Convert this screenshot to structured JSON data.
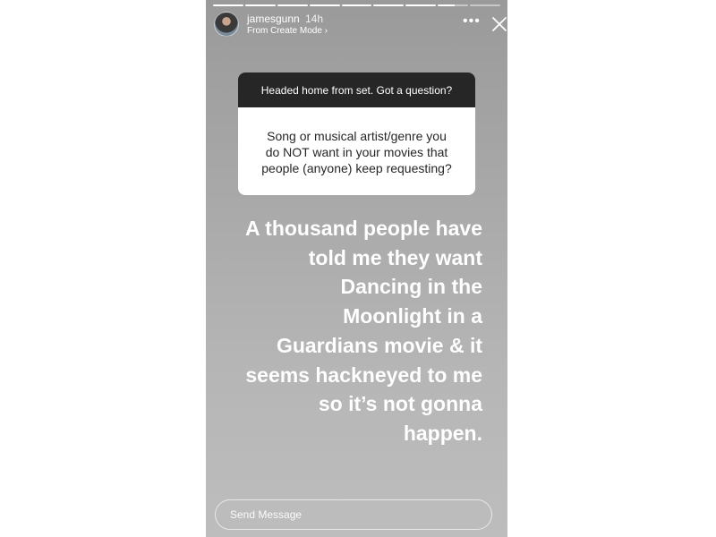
{
  "story": {
    "progress": [
      1,
      1,
      1,
      1,
      1,
      1,
      1,
      0.55,
      0
    ],
    "user": {
      "username": "jamesgunn",
      "time": "14h",
      "subtitle": "From Create Mode ›"
    },
    "icons": {
      "more": "more-horizontal-icon",
      "close": "close-icon",
      "more_glyph": "•••"
    },
    "question_box": {
      "header": "Headed home from set. Got a question?",
      "question": "Song or musical artist/genre you\ndo NOT want in your movies that\npeople (anyone) keep requesting?"
    },
    "answer": "A thousand people have\ntold me they want\nDancing in the\nMoonlight in a\nGuardians movie & it\nseems hackneyed to me\nso it’s not gonna\nhappen.",
    "reply": {
      "placeholder": "Send Message"
    }
  }
}
